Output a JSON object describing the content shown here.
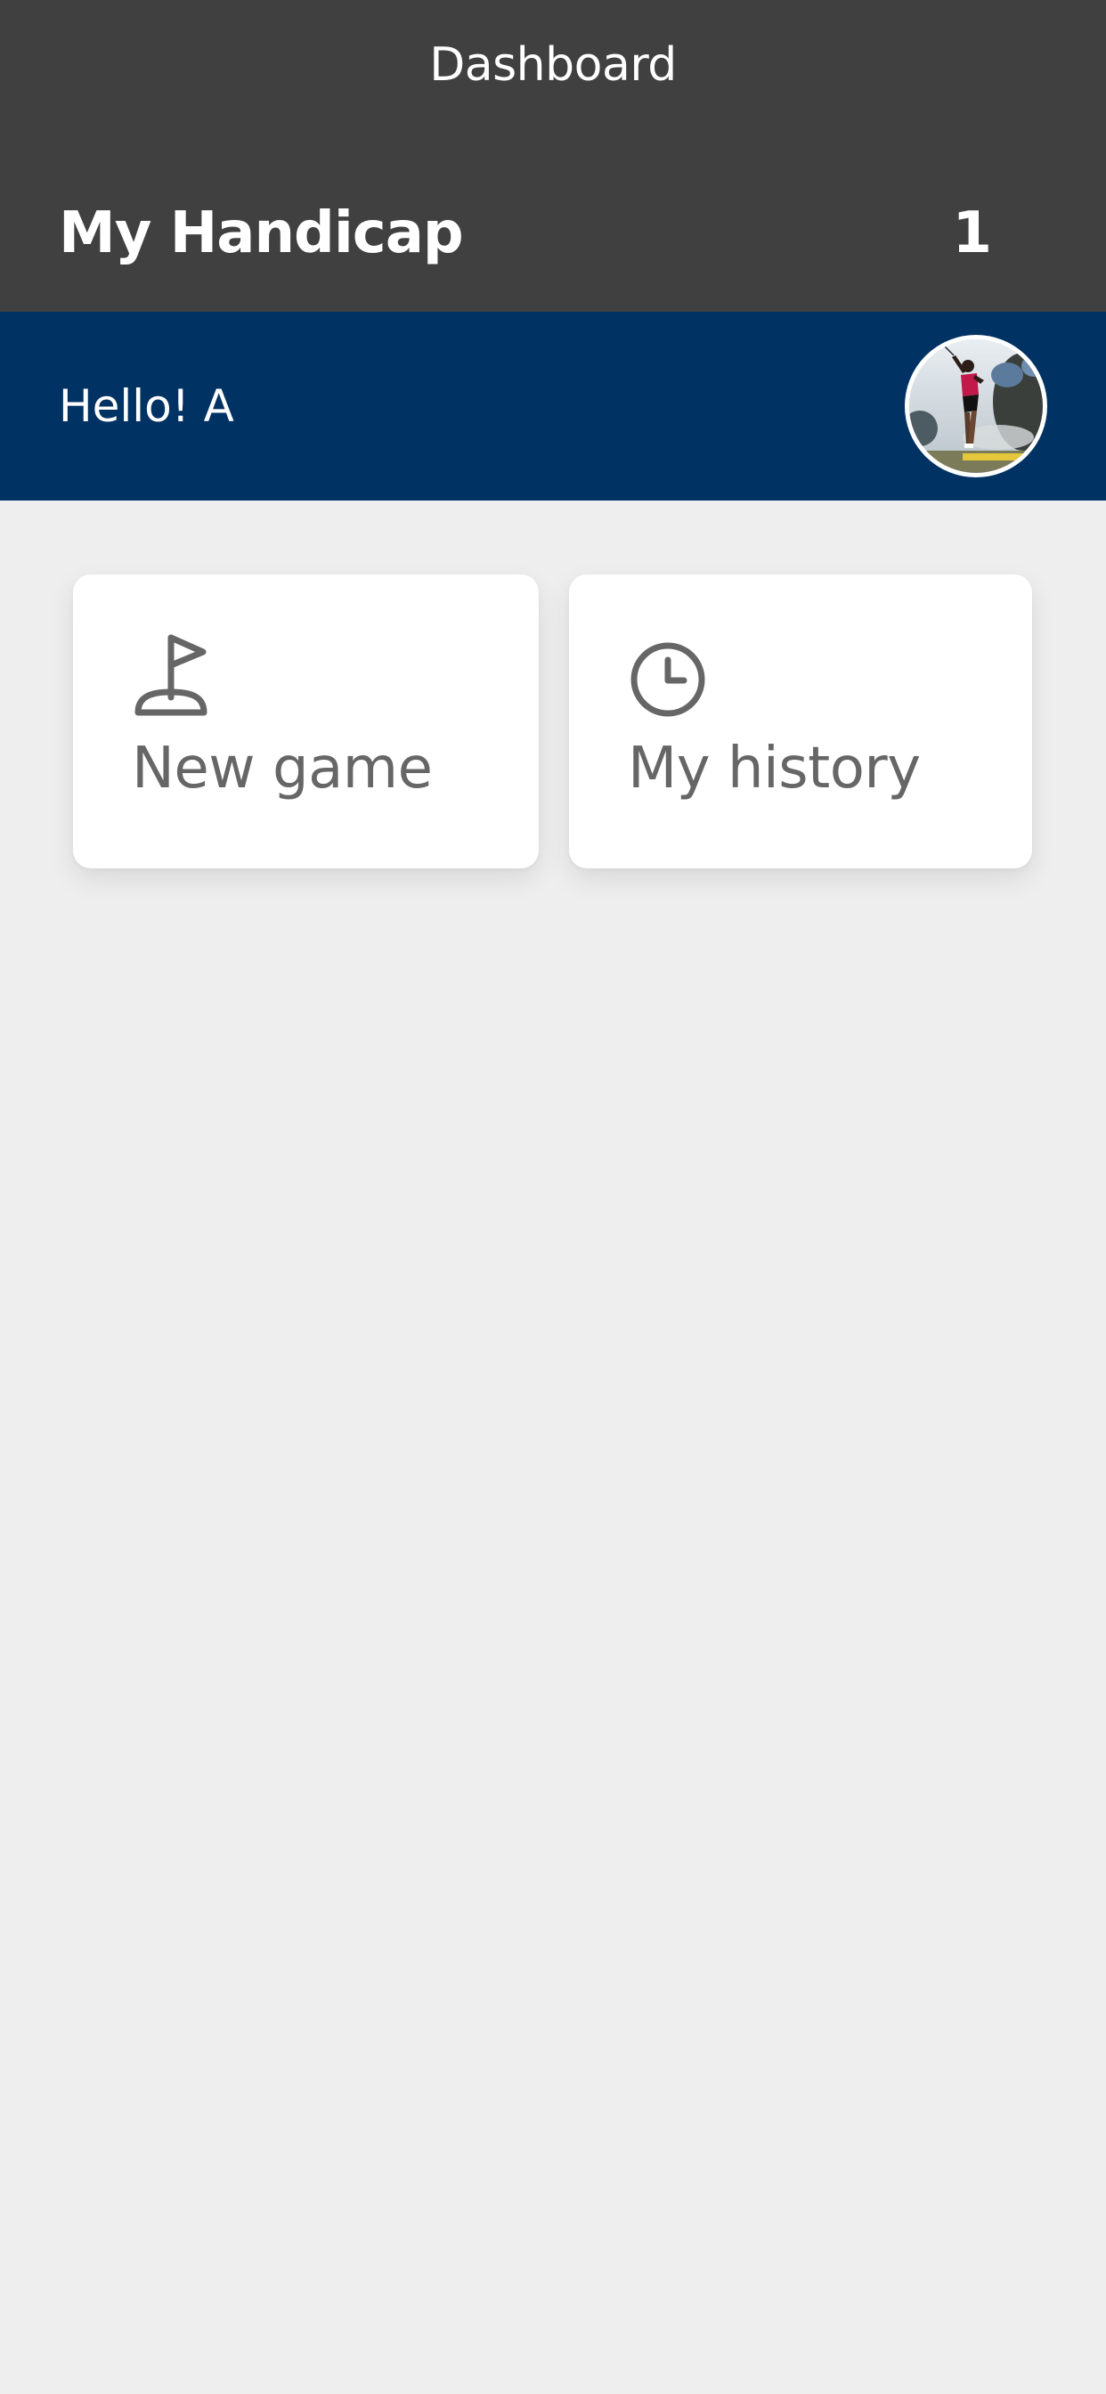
{
  "header": {
    "title": "Dashboard",
    "handicap_label": "My Handicap",
    "handicap_value": "1"
  },
  "greeting": {
    "text": "Hello! A"
  },
  "avatar": {
    "description": "golfer-photo"
  },
  "cards": [
    {
      "label": "New game",
      "icon": "golf-flag-icon"
    },
    {
      "label": "My history",
      "icon": "clock-icon"
    }
  ],
  "colors": {
    "header_bg": "#404041",
    "greeting_bg": "#003263",
    "page_bg": "#eeeeee",
    "card_bg": "#ffffff",
    "card_text": "#666666"
  }
}
